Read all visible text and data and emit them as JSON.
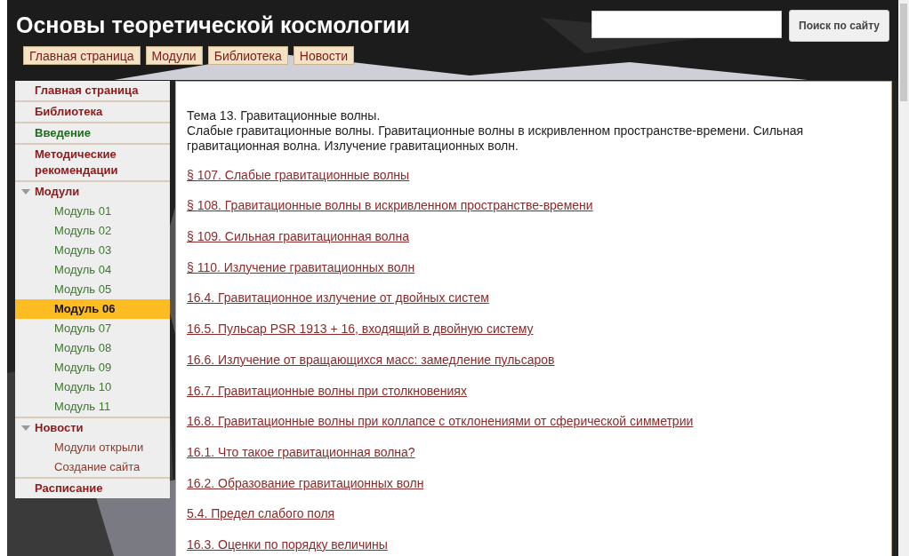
{
  "header": {
    "title": "Основы теоретической космологии"
  },
  "search": {
    "button": "Поиск по сайту"
  },
  "nav_tabs": [
    {
      "label": "Главная страница"
    },
    {
      "label": "Модули"
    },
    {
      "label": "Библиотека"
    },
    {
      "label": "Новости"
    }
  ],
  "sidebar": {
    "items": [
      {
        "label": "Главная страница",
        "color": "#8b1a1a"
      },
      {
        "label": "Библиотека",
        "color": "#8b1a1a"
      },
      {
        "label": "Введение",
        "color": "#1e6b1e"
      },
      {
        "label": "Методические рекомендации",
        "color": "#8b1a1a"
      },
      {
        "label": "Модули",
        "color": "#8b1a1a",
        "expanded": true,
        "kind": "modules",
        "children": [
          {
            "label": "Модуль 01",
            "selected": false
          },
          {
            "label": "Модуль 02",
            "selected": false
          },
          {
            "label": "Модуль 03",
            "selected": false
          },
          {
            "label": "Модуль 04",
            "selected": false
          },
          {
            "label": "Модуль 05",
            "selected": false
          },
          {
            "label": "Модуль 06",
            "selected": true
          },
          {
            "label": "Модуль 07",
            "selected": false
          },
          {
            "label": "Модуль 08",
            "selected": false
          },
          {
            "label": "Модуль 09",
            "selected": false
          },
          {
            "label": "Модуль 10",
            "selected": false
          },
          {
            "label": "Модуль 11",
            "selected": false
          }
        ]
      },
      {
        "label": "Новости",
        "color": "#8b1a1a",
        "expanded": true,
        "kind": "news",
        "children": [
          {
            "label": "Модули открыли",
            "selected": false
          },
          {
            "label": "Создание сайта",
            "selected": false
          }
        ]
      },
      {
        "label": "Расписание",
        "color": "#8b1a1a"
      }
    ]
  },
  "content": {
    "heading": "Тема 13. Гравитационные волны.",
    "summary": "Слабые гравитационные волны. Гравитационные волны в искривленном пространстве-времени. Сильная гравитационная волна. Излучение гравитационных волн.",
    "links": [
      "§ 107. Слабые гравитационные волны",
      "§ 108. Гравитационные волны в искривленном пространстве-времени",
      "§ 109. Сильная гравитационная волна",
      "§ 110. Излучение гравитационных волн",
      "16.4. Гравитационное излучение от двойных систем",
      "16.5. Пульсар PSR 1913 + 16, входящий в двойную систему",
      "16.6. Излучение от вращающихся масс: замедление пульсаров",
      "16.7. Гравитационные волны при столкновениях",
      "16.8. Гравитационные волны при коллапсе с отклонениями от сферической симметрии",
      "16.1. Что такое гравитационная волна?",
      "16.2. Образование гравитационных волн",
      "5.4. Предел слабого поля",
      "16.3. Оценки по порядку величины"
    ]
  }
}
